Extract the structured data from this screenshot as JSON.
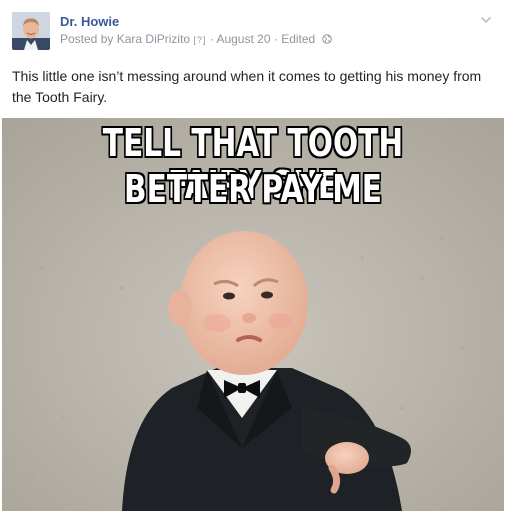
{
  "post": {
    "author": "Dr. Howie",
    "posted_by_prefix": "Posted by",
    "posted_by_name": "Kara DiPrizito",
    "info_marker": "[?]",
    "separator": "·",
    "date": "August 20",
    "edited": "Edited",
    "privacy_icon": "globe-icon",
    "options_icon": "chevron-down-icon",
    "message": "This little one isn’t messing around when it comes to getting his money from the Tooth Fairy.",
    "photo": {
      "meme_line_1": "TELL THAT TOOTH FAIRY SHE",
      "meme_line_2": "BETTER PAY ME"
    }
  },
  "colors": {
    "author_link": "#3b5998",
    "meta_text": "#90949c",
    "body_text": "#1d2129"
  }
}
